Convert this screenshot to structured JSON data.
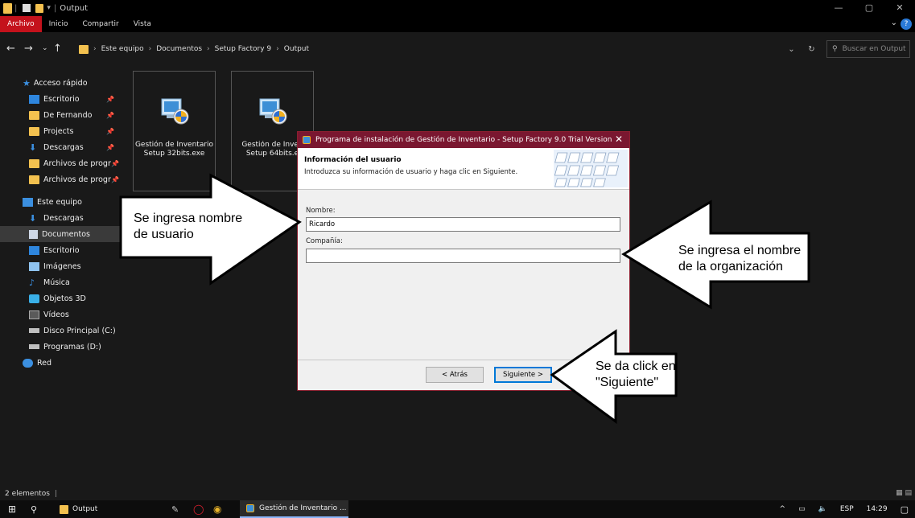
{
  "window": {
    "title": "Output",
    "controls": [
      "—",
      "▢",
      "✕"
    ]
  },
  "ribbon": {
    "tabs": [
      "Archivo",
      "Inicio",
      "Compartir",
      "Vista"
    ],
    "active_tab": "Archivo",
    "help": "?"
  },
  "address": {
    "crumbs": [
      "Este equipo",
      "Documentos",
      "Setup Factory 9",
      "Output"
    ],
    "search_placeholder": "Buscar en Output"
  },
  "sidebar": {
    "items": [
      {
        "label": "Acceso rápido",
        "icon": "star-icon",
        "pinned": false
      },
      {
        "label": "Escritorio",
        "icon": "desktop-icon",
        "pinned": true
      },
      {
        "label": "De Fernando",
        "icon": "folder-icon",
        "pinned": true
      },
      {
        "label": "Projects",
        "icon": "folder-icon",
        "pinned": true
      },
      {
        "label": "Descargas",
        "icon": "download-icon",
        "pinned": true
      },
      {
        "label": "Archivos de progr",
        "icon": "folder-icon",
        "pinned": true
      },
      {
        "label": "Archivos de progr",
        "icon": "folder-icon",
        "pinned": true
      },
      {
        "label": "Este equipo",
        "icon": "computer-icon",
        "pinned": false
      },
      {
        "label": "Descargas",
        "icon": "download-icon",
        "pinned": false
      },
      {
        "label": "Documentos",
        "icon": "documents-icon",
        "pinned": false
      },
      {
        "label": "Escritorio",
        "icon": "desktop-icon",
        "pinned": false
      },
      {
        "label": "Imágenes",
        "icon": "pictures-icon",
        "pinned": false
      },
      {
        "label": "Música",
        "icon": "music-icon",
        "pinned": false
      },
      {
        "label": "Objetos 3D",
        "icon": "objects3d-icon",
        "pinned": false
      },
      {
        "label": "Vídeos",
        "icon": "videos-icon",
        "pinned": false
      },
      {
        "label": "Disco Principal (C:)",
        "icon": "drive-icon",
        "pinned": false
      },
      {
        "label": "Programas (D:)",
        "icon": "drive-icon",
        "pinned": false
      },
      {
        "label": "Red",
        "icon": "network-icon",
        "pinned": false
      }
    ],
    "active_item": "Documentos"
  },
  "files": [
    {
      "line1": "Gestión de Inventario",
      "line2": "Setup 32bits.exe"
    },
    {
      "line1": "Gestión de Inven",
      "line2": "Setup 64bits.e"
    }
  ],
  "status": {
    "count": "2 elementos"
  },
  "taskbar": {
    "explorer": "Output",
    "setup": "Gestión de Inventario ...",
    "lang": "ESP",
    "time": "14:29"
  },
  "dialog": {
    "title": "Programa de instalación de Gestión de Inventario - Setup Factory 9.0 Trial Version",
    "close": "✕",
    "header_title": "Información del usuario",
    "header_subtitle": "Introduzca su información de usuario y haga clic en Siguiente.",
    "name_label": "Nombre:",
    "name_value": "Ricardo",
    "company_label": "Compañía:",
    "company_value": "",
    "back_label": "< Atrás",
    "next_label": "Siguiente >"
  },
  "annotations": {
    "name": [
      "Se ingresa nombre",
      "de usuario"
    ],
    "company": [
      "Se ingresa el nombre",
      "de la organización"
    ],
    "next": [
      "Se da click en",
      "\"Siguiente\""
    ]
  },
  "colors": {
    "accent_red": "#c4121c",
    "dialog_title": "#7a1730",
    "folder": "#f3c14f",
    "explorer_bg": "#191919"
  }
}
